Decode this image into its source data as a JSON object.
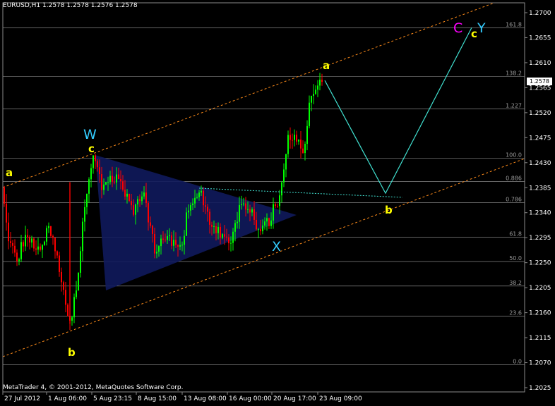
{
  "header": {
    "symbol": "EURUSD,H1",
    "ohlc": "1.2578 1.2578 1.2576 1.2578"
  },
  "footer": {
    "copyright": "MetaTrader 4, © 2001-2012, MetaQuotes Software Corp."
  },
  "current_price_tag": "1.2578",
  "colors": {
    "background": "#000000",
    "bull_candle": "#00ff00",
    "bear_candle": "#ff0000",
    "channel_line": "#ff8c1a",
    "wave_path": "#40e0d0",
    "triangle_fill": "#101a5c",
    "fib_line": "#bdbdbd",
    "wave_label_yellow": "#ffff00",
    "wave_label_cyan": "#33ccff",
    "wave_label_magenta": "#ff00ff"
  },
  "chart_data": {
    "type": "candlestick",
    "symbol": "EURUSD",
    "timeframe": "H1",
    "ylim": [
      1.2025,
      1.27
    ],
    "y_ticks": [
      "1.2700",
      "1.2655",
      "1.2610",
      "1.2565",
      "1.2520",
      "1.2475",
      "1.2430",
      "1.2385",
      "1.2340",
      "1.2295",
      "1.2250",
      "1.2205",
      "1.2160",
      "1.2115",
      "1.2070",
      "1.2025"
    ],
    "x_ticks": [
      "27 Jul 2012",
      "1 Aug 06:00",
      "5 Aug 23:15",
      "8 Aug 15:00",
      "13 Aug 08:00",
      "16 Aug 00:00",
      "20 Aug 17:00",
      "23 Aug 09:00"
    ],
    "fibonacci_levels": [
      {
        "label": "161.8",
        "price": 1.2673
      },
      {
        "label": "138.2",
        "price": 1.2585
      },
      {
        "label": "1.227",
        "price": 1.2527
      },
      {
        "label": "100.0",
        "price": 1.2438
      },
      {
        "label": "0.886",
        "price": 1.2396
      },
      {
        "label": "0.786",
        "price": 1.2358
      },
      {
        "label": "61.8",
        "price": 1.2296
      },
      {
        "label": "50.0",
        "price": 1.2252
      },
      {
        "label": "38.2",
        "price": 1.2208
      },
      {
        "label": "23.6",
        "price": 1.2154
      },
      {
        "label": "0.0",
        "price": 1.2066
      }
    ],
    "wave_labels": [
      {
        "text": "a",
        "color": "yellow",
        "size": "small"
      },
      {
        "text": "b",
        "color": "yellow",
        "size": "small"
      },
      {
        "text": "W",
        "color": "cyan",
        "size": "big"
      },
      {
        "text": "c",
        "color": "yellow",
        "size": "small"
      },
      {
        "text": "X",
        "color": "cyan",
        "size": "big"
      },
      {
        "text": "a",
        "color": "yellow",
        "size": "small"
      },
      {
        "text": "b",
        "color": "yellow",
        "size": "small"
      },
      {
        "text": "C",
        "color": "magenta",
        "size": "big"
      },
      {
        "text": "c",
        "color": "yellow",
        "size": "small"
      },
      {
        "text": "Y",
        "color": "cyan",
        "size": "big"
      }
    ],
    "projection_path_prices": [
      1.2578,
      1.2375,
      1.2673
    ]
  }
}
